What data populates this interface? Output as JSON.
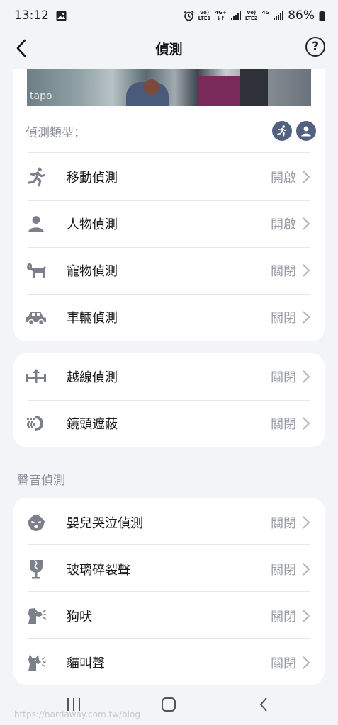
{
  "status_bar": {
    "time": "13:12",
    "sim1_top": "Vo)",
    "sim1_bottom": "LTE1",
    "net1_top": "4G+",
    "net1_bottom": "↓↑",
    "sim2_top": "Vo)",
    "sim2_bottom": "LTE2",
    "net2_top": "4G",
    "battery": "86%"
  },
  "header": {
    "title": "偵測"
  },
  "preview": {
    "brand": "tapo"
  },
  "detection": {
    "types_label": "偵測類型：",
    "type_icons": [
      "running-person-icon",
      "person-icon"
    ],
    "items": [
      {
        "icon": "running-person-icon",
        "label": "移動偵測",
        "value": "開啟"
      },
      {
        "icon": "person-icon",
        "label": "人物偵測",
        "value": "開啟"
      },
      {
        "icon": "dog-icon",
        "label": "寵物偵測",
        "value": "關閉"
      },
      {
        "icon": "car-icon",
        "label": "車輛偵測",
        "value": "關閉"
      }
    ]
  },
  "other": {
    "items": [
      {
        "icon": "line-crossing-icon",
        "label": "越線偵測",
        "value": "關閉"
      },
      {
        "icon": "lens-obstruction-icon",
        "label": "鏡頭遮蔽",
        "value": "關閉"
      }
    ]
  },
  "sound": {
    "title": "聲音偵測",
    "items": [
      {
        "icon": "crying-baby-icon",
        "label": "嬰兒哭泣偵測",
        "value": "關閉"
      },
      {
        "icon": "broken-glass-icon",
        "label": "玻璃碎裂聲",
        "value": "關閉"
      },
      {
        "icon": "barking-dog-icon",
        "label": "狗吠",
        "value": "關閉"
      },
      {
        "icon": "meowing-cat-icon",
        "label": "貓叫聲",
        "value": "關閉"
      }
    ]
  },
  "watermark": "https://nardaway.com.tw/blog",
  "colors": {
    "background": "#f3f4f8",
    "card": "#ffffff",
    "accent": "#536080",
    "muted": "#9a9ea6",
    "icon": "#7c808a"
  }
}
